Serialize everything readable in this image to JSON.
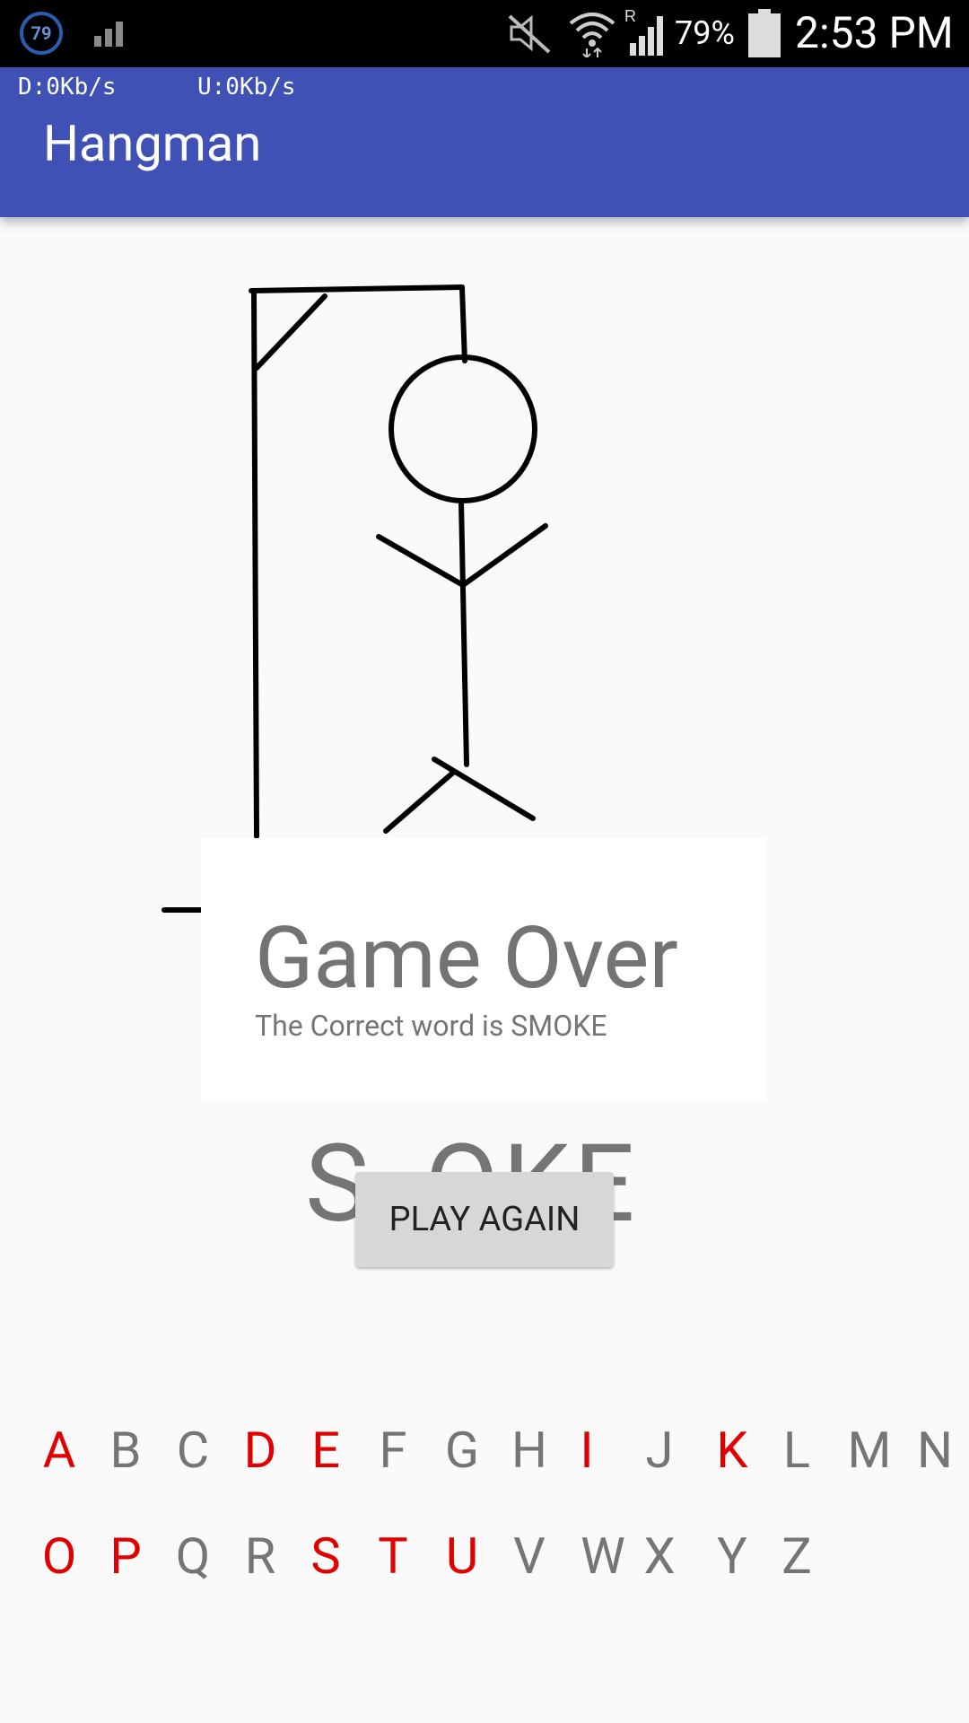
{
  "status_bar": {
    "notification_count": "79",
    "battery_percent": "79%",
    "time": "2:53 PM",
    "icons": [
      "small-signal-icon",
      "mute-icon",
      "wifi-icon",
      "signal-icon",
      "battery-icon"
    ]
  },
  "network_speed": {
    "download": "D:0Kb/s",
    "upload": "U:0Kb/s"
  },
  "app_bar": {
    "title": "Hangman",
    "color": "#3f51b5"
  },
  "dialog": {
    "title": "Game Over",
    "message": "The Correct word is SMOKE",
    "button_label": "PLAY AGAIN"
  },
  "word_display": "S_OKE",
  "keyboard": {
    "used_color": "#e00000",
    "unused_color": "#757575",
    "row1": [
      {
        "letter": "A",
        "used": true
      },
      {
        "letter": "B",
        "used": false
      },
      {
        "letter": "C",
        "used": false
      },
      {
        "letter": "D",
        "used": true
      },
      {
        "letter": "E",
        "used": true
      },
      {
        "letter": "F",
        "used": false
      },
      {
        "letter": "G",
        "used": false
      },
      {
        "letter": "H",
        "used": false
      },
      {
        "letter": "I",
        "used": true
      },
      {
        "letter": "J",
        "used": false
      },
      {
        "letter": "K",
        "used": true
      },
      {
        "letter": "L",
        "used": false
      },
      {
        "letter": "M",
        "used": false
      },
      {
        "letter": "N",
        "used": false
      }
    ],
    "row2": [
      {
        "letter": "O",
        "used": true
      },
      {
        "letter": "P",
        "used": true
      },
      {
        "letter": "Q",
        "used": false
      },
      {
        "letter": "R",
        "used": false
      },
      {
        "letter": "S",
        "used": true
      },
      {
        "letter": "T",
        "used": true
      },
      {
        "letter": "U",
        "used": true
      },
      {
        "letter": "V",
        "used": false
      },
      {
        "letter": "W",
        "used": false
      },
      {
        "letter": "X",
        "used": false
      },
      {
        "letter": "Y",
        "used": false
      },
      {
        "letter": "Z",
        "used": false
      }
    ]
  }
}
